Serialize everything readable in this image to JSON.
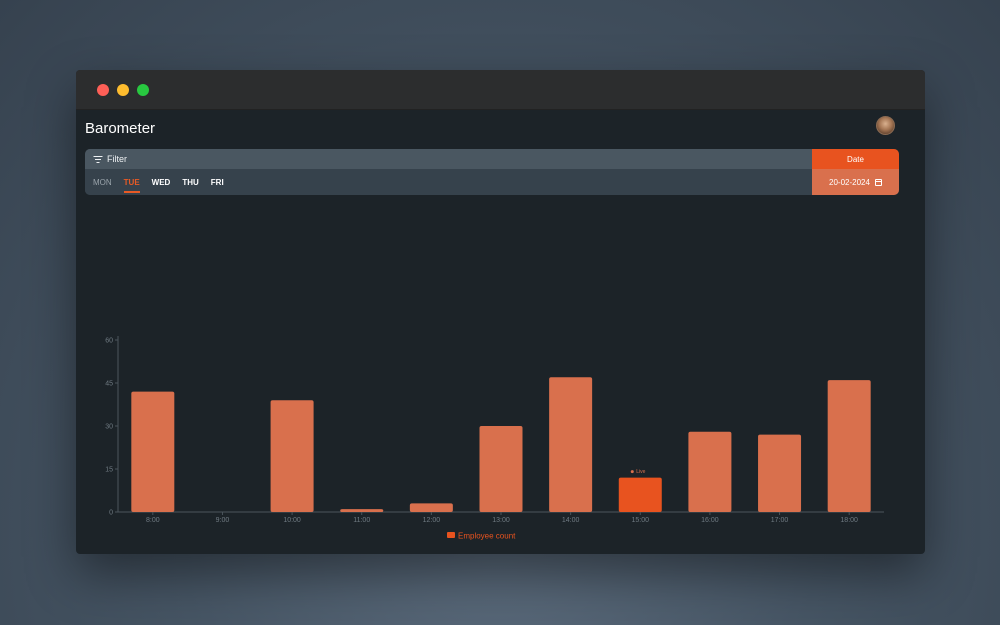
{
  "app": {
    "title": "Barometer"
  },
  "filter": {
    "label": "Filter",
    "icon": "filter-icon"
  },
  "days": [
    {
      "label": "MON",
      "state": "muted"
    },
    {
      "label": "TUE",
      "state": "active"
    },
    {
      "label": "WED",
      "state": "normal"
    },
    {
      "label": "THU",
      "state": "normal"
    },
    {
      "label": "FRI",
      "state": "normal"
    }
  ],
  "date": {
    "label": "Date",
    "value": "20-02-2024",
    "icon": "calendar-icon"
  },
  "colors": {
    "accent": "#e8531f",
    "bar": "#d9704d",
    "live_bar": "#e8531f"
  },
  "chart_data": {
    "type": "bar",
    "categories": [
      "8:00",
      "9:00",
      "10:00",
      "11:00",
      "12:00",
      "13:00",
      "14:00",
      "15:00",
      "16:00",
      "17:00",
      "18:00"
    ],
    "series": [
      {
        "name": "Employee count",
        "values": [
          42,
          0,
          39,
          1,
          3,
          30,
          47,
          12,
          28,
          27,
          46
        ]
      }
    ],
    "highlight": {
      "category": "15:00",
      "label": "Live"
    },
    "yticks": [
      0,
      15,
      30,
      45,
      60
    ],
    "ylim": [
      0,
      60
    ],
    "legend": "bottom-center",
    "grid": false
  }
}
